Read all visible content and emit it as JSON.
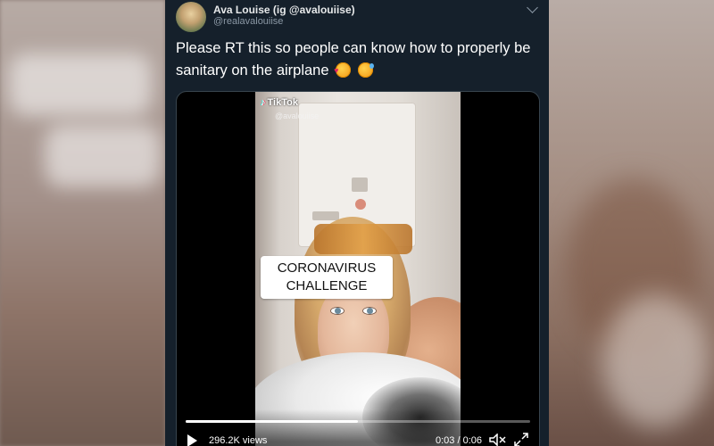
{
  "tweet": {
    "display_name": "Ava Louise (ig @avalouiise)",
    "handle": "@realavalouiise",
    "text": "Please RT this so people can know how to properly be sanitary on the airplane",
    "icons": [
      "chevron-down-icon",
      "smiling-face-with-hearts-emoji",
      "grinning-sweat-emoji"
    ]
  },
  "video": {
    "tiktok_brand": "TikTok",
    "tiktok_user": "@avalouiise",
    "caption": "CORONAVIRUS CHALLENGE",
    "views": "296.2K views",
    "time": "0:03 / 0:06",
    "progress": 0.5,
    "icons": [
      "play-icon",
      "mute-icon",
      "fullscreen-icon"
    ]
  },
  "colors": {
    "tweet_bg": "#15202b",
    "text_primary": "#ffffff",
    "text_secondary": "#8b98a5",
    "border": "#38444d"
  }
}
